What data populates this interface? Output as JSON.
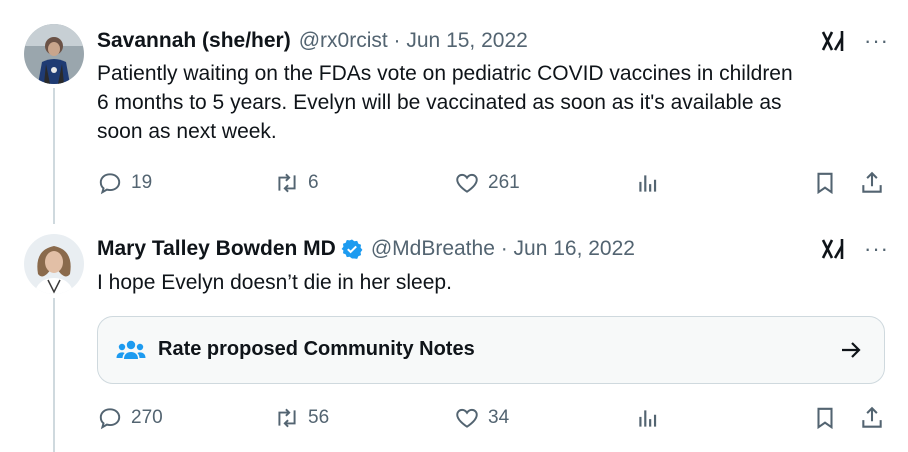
{
  "tweet1": {
    "display_name": "Savannah (she/her)",
    "meta": "@rx0rcist · Jun 15, 2022",
    "text_lines": [
      "Patiently waiting on the FDAs vote on pediatric COVID vaccines in children",
      "6 months to 5 years. Evelyn will be vaccinated as soon as it's available as",
      "soon as next week."
    ],
    "replies": "19",
    "reposts": "6",
    "likes": "261"
  },
  "tweet2": {
    "display_name": "Mary Talley Bowden MD",
    "meta": "@MdBreathe · Jun 16, 2022",
    "text": "I hope Evelyn doesn’t die in her sleep.",
    "community_notes_label": "Rate proposed Community Notes",
    "replies": "270",
    "reposts": "56",
    "likes": "34"
  },
  "more_glyph": "···",
  "icons": {
    "grok": "grok-icon",
    "reply": "reply-icon",
    "repost": "repost-icon",
    "like": "heart-icon",
    "views": "views-icon",
    "bookmark": "bookmark-icon",
    "share": "share-icon",
    "verified": "verified-badge-icon",
    "community_notes": "community-notes-icon",
    "arrow": "arrow-right-icon"
  },
  "colors": {
    "accent": "#1d9bf0",
    "text": "#0f1419",
    "muted": "#536471",
    "border": "#cfd9de",
    "card_bg": "#f7f9f9"
  }
}
